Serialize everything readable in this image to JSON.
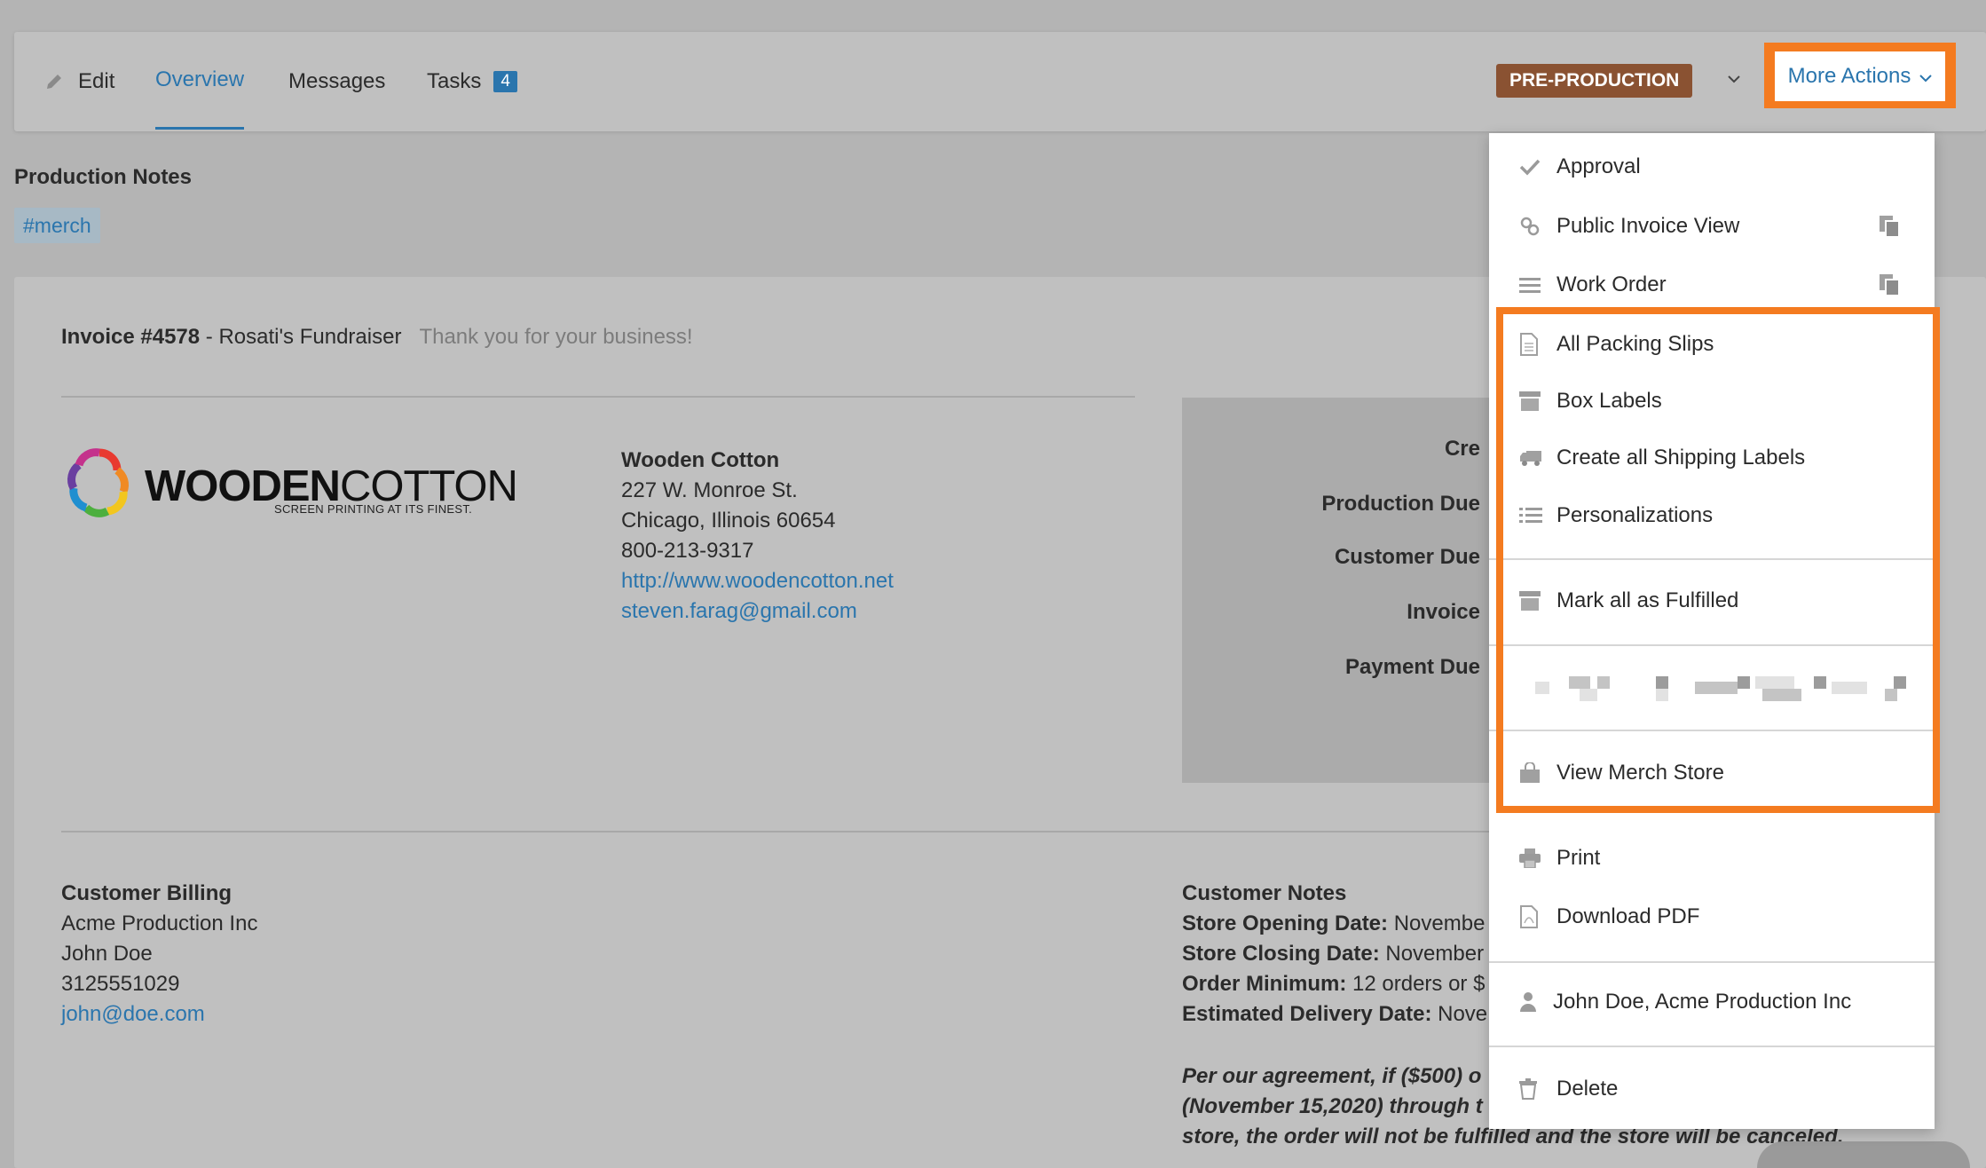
{
  "tabs": {
    "edit": "Edit",
    "overview": "Overview",
    "messages": "Messages",
    "tasks": "Tasks",
    "tasks_count": "4"
  },
  "status": {
    "label": "PRE-PRODUCTION"
  },
  "more_actions": {
    "label": "More Actions"
  },
  "production_notes": {
    "title": "Production Notes",
    "tag": "#merch"
  },
  "invoice": {
    "number": "Invoice #4578",
    "name": " - Rosati's Fundraiser",
    "thanks": "Thank you for your business!"
  },
  "logo": {
    "wordmark_bold": "WOODEN",
    "wordmark_light": "COTTON",
    "tagline": "SCREEN PRINTING AT ITS FINEST."
  },
  "company": {
    "name": "Wooden Cotton",
    "street": "227 W. Monroe St.",
    "city": "Chicago, Illinois 60654",
    "phone": "800-213-9317",
    "website": "http://www.woodencotton.net",
    "email": "steven.farag@gmail.com"
  },
  "dates": {
    "created": "Cre",
    "production_due": "Production Due",
    "customer_due": "Customer Due",
    "invoice": "Invoice",
    "payment_due": "Payment Due"
  },
  "billing": {
    "heading": "Customer Billing",
    "company": "Acme Production Inc",
    "contact": "John Doe",
    "phone": "3125551029",
    "email": "john@doe.com"
  },
  "customer_notes": {
    "heading": "Customer Notes",
    "opening_label": "Store Opening Date:",
    "opening_value": " Novembe",
    "closing_label": "Store Closing Date:",
    "closing_value": " November",
    "minimum_label": "Order Minimum:",
    "minimum_value": " 12 orders or $",
    "delivery_label": "Estimated Delivery Date:",
    "delivery_value": " Nove",
    "agreement_line1": "Per our agreement, if ($500) o",
    "agreement_line2": "(November 15,2020) through t",
    "agreement_line3": "store, the order will not be fulfilled and the store will be canceled."
  },
  "menu": {
    "approval": "Approval",
    "public_invoice": "Public Invoice View",
    "work_order": "Work Order",
    "packing_slips": "All Packing Slips",
    "box_labels": "Box Labels",
    "shipping_labels": "Create all Shipping Labels",
    "personalizations": "Personalizations",
    "mark_fulfilled": "Mark all as Fulfilled",
    "view_store": "View Merch Store",
    "print": "Print",
    "download_pdf": "Download PDF",
    "customer": "John Doe, Acme Production Inc",
    "delete": "Delete"
  },
  "colors": {
    "accent": "#2a75ad",
    "highlight": "#f47b20",
    "status": "#8a5232"
  }
}
